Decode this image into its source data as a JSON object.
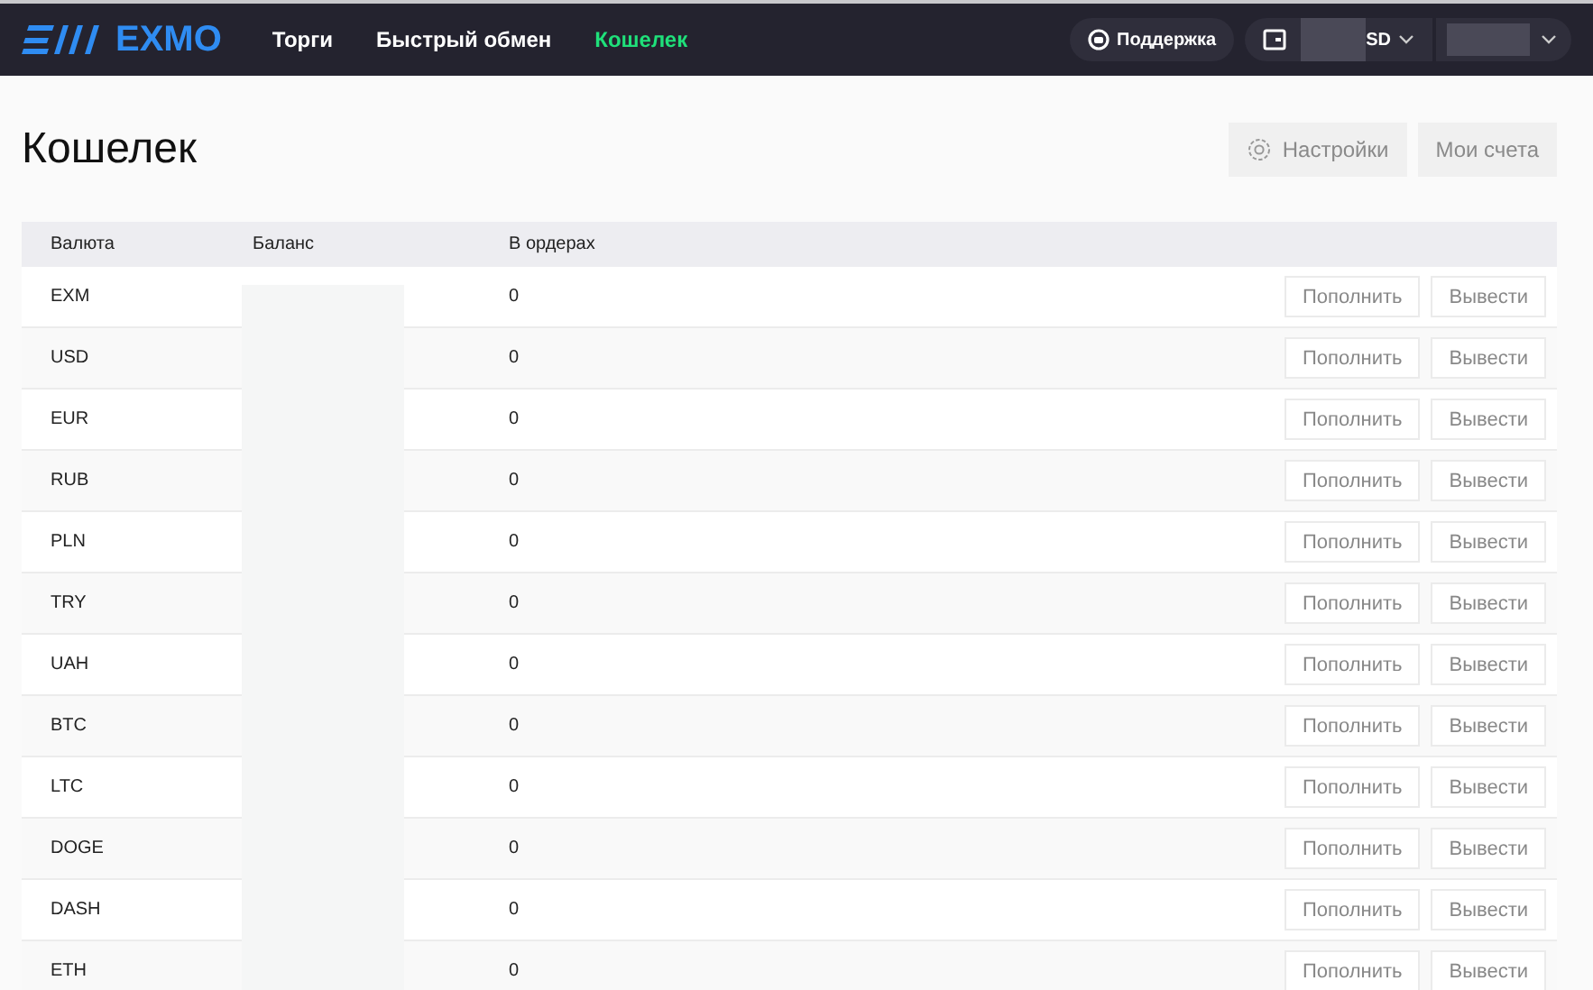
{
  "header": {
    "logo": "EXMO",
    "nav": [
      {
        "label": "Торги",
        "selected": false
      },
      {
        "label": "Быстрый обмен",
        "selected": false
      },
      {
        "label": "Кошелек",
        "selected": true
      }
    ],
    "support": "Поддержка",
    "balance_currency": "SD"
  },
  "page": {
    "title": "Кошелек",
    "actions": [
      {
        "label": "Настройки",
        "kind": "settings"
      },
      {
        "label": "Мои счета",
        "kind": "plain"
      }
    ]
  },
  "table": {
    "columns": [
      "Валюта",
      "Баланс",
      "В ордерах"
    ],
    "rows": [
      {
        "currency": "EXM",
        "in_orders": "0",
        "deposit": "Пополнить",
        "withdraw": "Вывести"
      },
      {
        "currency": "USD",
        "in_orders": "0",
        "deposit": "Пополнить",
        "withdraw": "Вывести"
      },
      {
        "currency": "EUR",
        "in_orders": "0",
        "deposit": "Пополнить",
        "withdraw": "Вывести"
      },
      {
        "currency": "RUB",
        "in_orders": "0",
        "deposit": "Пополнить",
        "withdraw": "Вывести"
      },
      {
        "currency": "PLN",
        "in_orders": "0",
        "deposit": "Пополнить",
        "withdraw": "Вывести"
      },
      {
        "currency": "TRY",
        "in_orders": "0",
        "deposit": "Пополнить",
        "withdraw": "Вывести"
      },
      {
        "currency": "UAH",
        "in_orders": "0",
        "deposit": "Пополнить",
        "withdraw": "Вывести"
      },
      {
        "currency": "BTC",
        "in_orders": "0",
        "deposit": "Пополнить",
        "withdraw": "Вывести"
      },
      {
        "currency": "LTC",
        "in_orders": "0",
        "deposit": "Пополнить",
        "withdraw": "Вывести"
      },
      {
        "currency": "DOGE",
        "in_orders": "0",
        "deposit": "Пополнить",
        "withdraw": "Вывести"
      },
      {
        "currency": "DASH",
        "in_orders": "0",
        "deposit": "Пополнить",
        "withdraw": "Вывести"
      },
      {
        "currency": "ETH",
        "in_orders": "0",
        "deposit": "Пополнить",
        "withdraw": "Вывести"
      }
    ]
  }
}
